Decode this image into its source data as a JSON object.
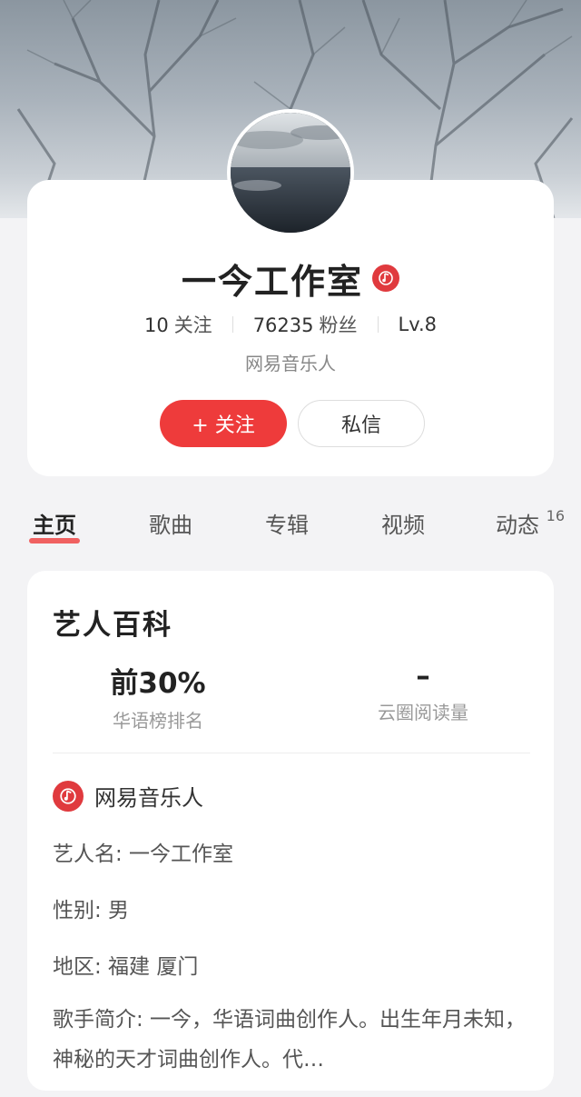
{
  "profile": {
    "name": "一今工作室",
    "following_count": "10",
    "following_label": "关注",
    "fans_count": "76235",
    "fans_label": "粉丝",
    "level": "Lv.8",
    "subtitle": "网易音乐人",
    "follow_button": "+ 关注",
    "message_button": "私信"
  },
  "tabs": [
    {
      "label": "主页",
      "active": true
    },
    {
      "label": "歌曲"
    },
    {
      "label": "专辑"
    },
    {
      "label": "视频"
    },
    {
      "label": "动态",
      "badge": "16"
    }
  ],
  "info": {
    "title": "艺人百科",
    "metrics": [
      {
        "value": "前30%",
        "label": "华语榜排名"
      },
      {
        "value": "–",
        "label": "云圈阅读量"
      }
    ],
    "role": "网易音乐人",
    "artist_name": "艺人名: 一今工作室",
    "gender": "性别: 男",
    "region": "地区: 福建 厦门",
    "bio": "歌手简介: 一今，华语词曲创作人。出生年月未知，神秘的天才词曲创作人。代…"
  },
  "colors": {
    "accent": "#ee3b3b",
    "badge": "#e03a3e",
    "tab_underline": "#f06161"
  },
  "icons": {
    "verified": "music-note-badge-icon"
  }
}
